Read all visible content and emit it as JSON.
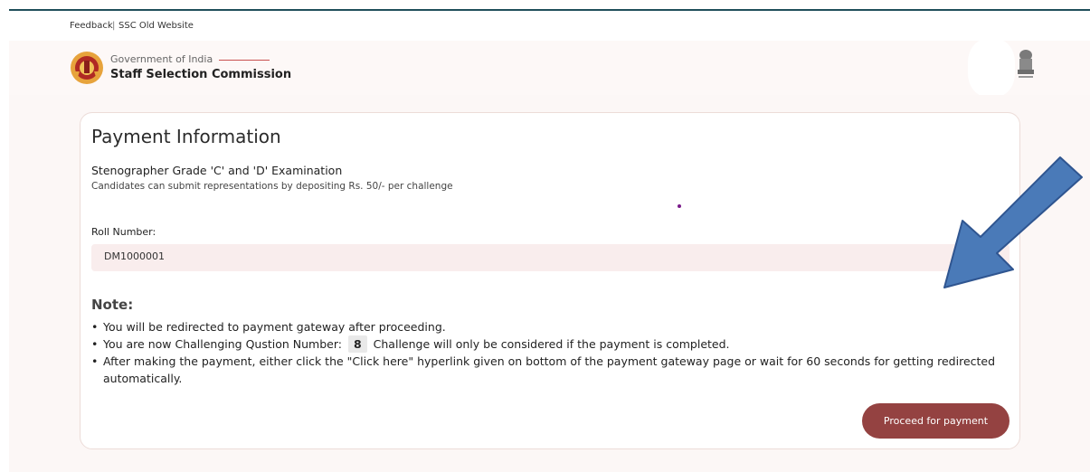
{
  "topbar": {
    "feedback": "Feedback",
    "separator": "|",
    "old_site": "SSC Old Website"
  },
  "header": {
    "org_small": "Government of India",
    "org_big": "Staff Selection Commission"
  },
  "card": {
    "title": "Payment Information",
    "exam_name": "Stenographer Grade 'C' and 'D' Examination",
    "fee_note": "Candidates can submit representations by depositing Rs. 50/- per challenge",
    "roll_label": "Roll Number:",
    "roll_value": "DM1000001",
    "note_heading": "Note:",
    "bullets": {
      "one": "You will be redirected to payment gateway after proceeding.",
      "two_pre": "You are now Challenging Qustion Number:",
      "question_number": "8",
      "two_post": "Challenge will only be considered if the payment is completed.",
      "three_line1": "After making the payment, either click the \"Click here\" hyperlink given on bottom of the payment gateway page or wait for 60 seconds for getting redirected",
      "three_line2": "automatically."
    },
    "proceed_label": "Proceed for payment"
  },
  "colors": {
    "primary_button": "#944241",
    "annotation_arrow": "#4a7ab8"
  },
  "icons": {
    "logo": "ssc-emblem-icon",
    "national": "national-emblem-icon",
    "annotation": "annotation-arrow"
  }
}
